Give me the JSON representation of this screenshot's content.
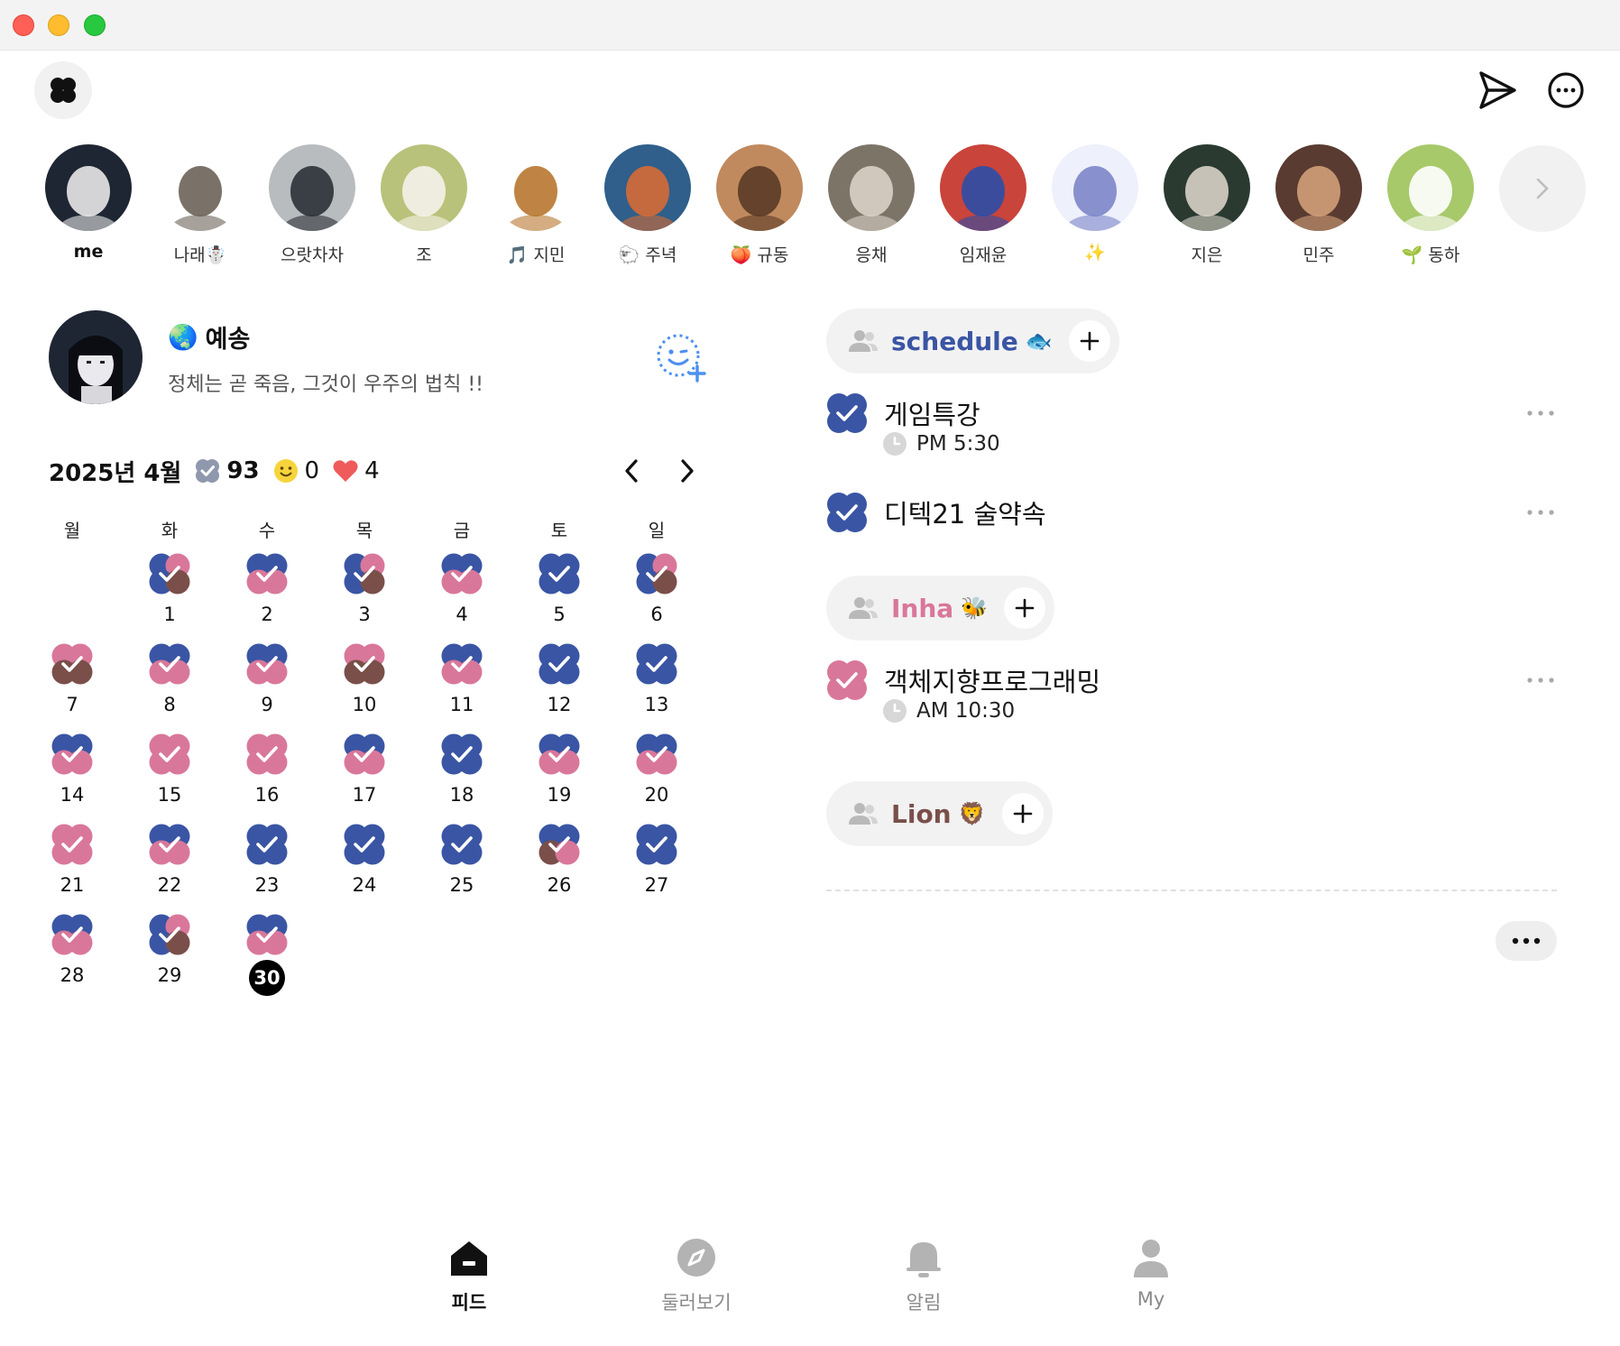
{
  "colors": {
    "blue": "#3a55a4",
    "pink": "#d9779a",
    "brown": "#7a4f4a",
    "gray": "#f2f2f2"
  },
  "header": {
    "logo_icon": "clover-logo-icon",
    "send_icon": "paper-plane-icon",
    "more_icon": "more-circle-icon"
  },
  "friends": [
    {
      "name": "me",
      "bg": "#1f2633",
      "fg": "#e8e8e8"
    },
    {
      "name": "나래☃️",
      "bg": "#ffffff",
      "fg": "#6b6259"
    },
    {
      "name": "으랏차차",
      "bg": "#b8bcbe",
      "fg": "#2b3136"
    },
    {
      "name": "조",
      "bg": "#b9c27a",
      "fg": "#f5f2ea"
    },
    {
      "name": "🎵 지민",
      "bg": "#ffffff",
      "fg": "#b8772f"
    },
    {
      "name": "🐑 주녁",
      "bg": "#2f5f8a",
      "fg": "#d66a36"
    },
    {
      "name": "🍑 규동",
      "bg": "#c08a5e",
      "fg": "#5a3a26"
    },
    {
      "name": "응채",
      "bg": "#7d7468",
      "fg": "#d9d2c7"
    },
    {
      "name": "임재윤",
      "bg": "#c9443b",
      "fg": "#2c4ea8"
    },
    {
      "name": "✨",
      "bg": "#eef0fb",
      "fg": "#7c86c9"
    },
    {
      "name": "지은",
      "bg": "#2a3a31",
      "fg": "#d8d2c6"
    },
    {
      "name": "민주",
      "bg": "#5a3b31",
      "fg": "#d0a07a"
    },
    {
      "name": "🌱 동하",
      "bg": "#a7c96a",
      "fg": "#ffffff"
    }
  ],
  "profile": {
    "emoji": "🌏",
    "name": "예송",
    "bio": "정체는 곧 죽음, 그것이 우주의 법칙 !!"
  },
  "month": {
    "label": "2025년 4월",
    "done_count": "93",
    "smile_count": "0",
    "heart_count": "4"
  },
  "weekdays": [
    "월",
    "화",
    "수",
    "목",
    "금",
    "토",
    "일"
  ],
  "days": [
    {
      "n": "1",
      "c": [
        "blue",
        "pink",
        "blue",
        "brown"
      ]
    },
    {
      "n": "2",
      "c": [
        "blue",
        "blue",
        "pink",
        "pink"
      ]
    },
    {
      "n": "3",
      "c": [
        "blue",
        "pink",
        "blue",
        "brown"
      ]
    },
    {
      "n": "4",
      "c": [
        "blue",
        "blue",
        "pink",
        "pink"
      ]
    },
    {
      "n": "5",
      "c": [
        "blue",
        "blue",
        "blue",
        "blue"
      ]
    },
    {
      "n": "6",
      "c": [
        "blue",
        "pink",
        "blue",
        "brown"
      ]
    },
    {
      "n": "7",
      "c": [
        "pink",
        "pink",
        "brown",
        "brown"
      ]
    },
    {
      "n": "8",
      "c": [
        "blue",
        "blue",
        "pink",
        "pink"
      ]
    },
    {
      "n": "9",
      "c": [
        "blue",
        "blue",
        "pink",
        "pink"
      ]
    },
    {
      "n": "10",
      "c": [
        "pink",
        "pink",
        "brown",
        "brown"
      ]
    },
    {
      "n": "11",
      "c": [
        "blue",
        "blue",
        "pink",
        "pink"
      ]
    },
    {
      "n": "12",
      "c": [
        "blue",
        "blue",
        "blue",
        "blue"
      ]
    },
    {
      "n": "13",
      "c": [
        "blue",
        "blue",
        "blue",
        "blue"
      ]
    },
    {
      "n": "14",
      "c": [
        "blue",
        "blue",
        "pink",
        "pink"
      ]
    },
    {
      "n": "15",
      "c": [
        "pink",
        "pink",
        "pink",
        "pink"
      ]
    },
    {
      "n": "16",
      "c": [
        "pink",
        "pink",
        "pink",
        "pink"
      ]
    },
    {
      "n": "17",
      "c": [
        "blue",
        "blue",
        "pink",
        "pink"
      ]
    },
    {
      "n": "18",
      "c": [
        "blue",
        "blue",
        "blue",
        "blue"
      ]
    },
    {
      "n": "19",
      "c": [
        "blue",
        "blue",
        "pink",
        "pink"
      ]
    },
    {
      "n": "20",
      "c": [
        "blue",
        "blue",
        "pink",
        "pink"
      ]
    },
    {
      "n": "21",
      "c": [
        "pink",
        "pink",
        "pink",
        "pink"
      ]
    },
    {
      "n": "22",
      "c": [
        "blue",
        "blue",
        "pink",
        "pink"
      ]
    },
    {
      "n": "23",
      "c": [
        "blue",
        "blue",
        "blue",
        "blue"
      ]
    },
    {
      "n": "24",
      "c": [
        "blue",
        "blue",
        "blue",
        "blue"
      ]
    },
    {
      "n": "25",
      "c": [
        "blue",
        "blue",
        "blue",
        "blue"
      ]
    },
    {
      "n": "26",
      "c": [
        "blue",
        "blue",
        "brown",
        "pink"
      ]
    },
    {
      "n": "27",
      "c": [
        "blue",
        "blue",
        "blue",
        "blue"
      ]
    },
    {
      "n": "28",
      "c": [
        "blue",
        "blue",
        "pink",
        "pink"
      ]
    },
    {
      "n": "29",
      "c": [
        "blue",
        "pink",
        "blue",
        "brown"
      ]
    },
    {
      "n": "30",
      "c": [
        "blue",
        "blue",
        "pink",
        "pink"
      ],
      "today": true
    }
  ],
  "groups": [
    {
      "name": "schedule",
      "emoji": "🐟",
      "color": "#3a55a4",
      "todos": [
        {
          "title": "게임특강",
          "time": "PM 5:30"
        },
        {
          "title": "디텍21 술약속",
          "time": ""
        }
      ]
    },
    {
      "name": "Inha",
      "emoji": "🐝",
      "color": "#d9779a",
      "todos": [
        {
          "title": "객체지향프로그래밍",
          "time": "AM 10:30"
        }
      ]
    },
    {
      "name": "Lion",
      "emoji": "🦁",
      "color": "#7a4f4a",
      "todos": []
    }
  ],
  "nav": [
    {
      "label": "피드",
      "icon": "home-icon",
      "active": true
    },
    {
      "label": "둘러보기",
      "icon": "compass-icon",
      "active": false
    },
    {
      "label": "알림",
      "icon": "bell-icon",
      "active": false
    },
    {
      "label": "My",
      "icon": "person-icon",
      "active": false
    }
  ]
}
